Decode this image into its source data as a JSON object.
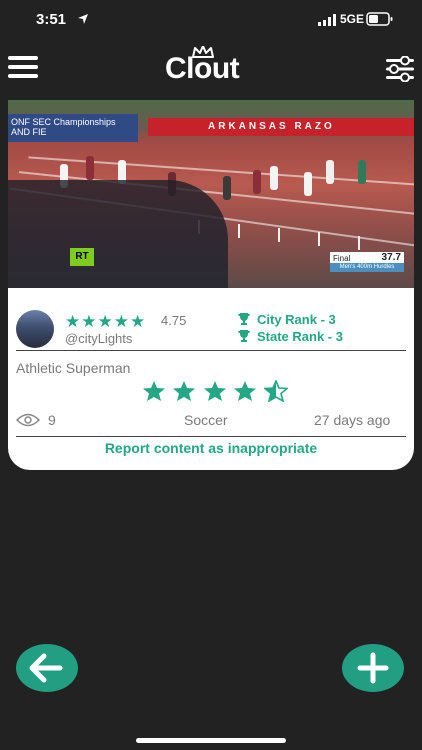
{
  "status_bar": {
    "time": "3:51",
    "network": "5GE"
  },
  "header": {
    "logo": "Clout"
  },
  "post": {
    "scoreboard": {
      "label": "Final",
      "value": "37.7",
      "event": "Men's 400m Hurdles"
    },
    "board_text": "ONF SEC Championships AND FIE",
    "banner_text": "ARKANSAS   RAZO",
    "watermark": "RT",
    "owner": {
      "rating": "4.75",
      "username": "@cityLights"
    },
    "ranks": {
      "city": "City Rank - 3",
      "state": "State Rank - 3"
    },
    "title": "Athletic Superman",
    "post_rating_stars": 4.5,
    "views": "9",
    "category": "Soccer",
    "age": "27 days ago",
    "report_label": "Report content as inappropriate"
  },
  "colors": {
    "accent": "#23a787",
    "background": "#222222",
    "card": "#ffffff"
  }
}
